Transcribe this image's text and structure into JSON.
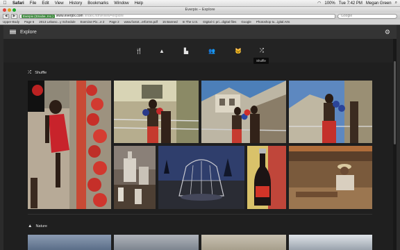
{
  "menubar": {
    "apple": "",
    "items": [
      "Safari",
      "File",
      "Edit",
      "View",
      "History",
      "Bookmarks",
      "Window",
      "Help"
    ],
    "status": {
      "battery": "100%",
      "day_time": "Tue 7:42 PM",
      "user": "Megan Green"
    }
  },
  "window": {
    "title": "Everpix – Explore"
  },
  "browser": {
    "back": "◀",
    "forward": "▶",
    "cert_label": "Everpix (33cube, Inc.)",
    "url_host": "www.everpix.com",
    "url_path": "/index.html#view=explore",
    "search_placeholder": "Google",
    "bookmarks": [
      "Upper-Body",
      "Page 6",
      "2013 Lebano...y Schedule",
      "Exercise Pix...e 2",
      "Page 2",
      "www.foxtot...erforms.pdf",
      "15 Banned",
      "In The U.S.",
      "Digital C pri...digital files",
      "Google",
      "Photoshop tu...igital Arts"
    ]
  },
  "app": {
    "title": "Explore",
    "filters": [
      {
        "name": "filter-food-icon",
        "glyph": "🍴"
      },
      {
        "name": "filter-landscape-icon",
        "glyph": "▲"
      },
      {
        "name": "filter-city-icon",
        "glyph": "▙"
      },
      {
        "name": "filter-people-icon",
        "glyph": "👥"
      },
      {
        "name": "filter-pets-icon",
        "glyph": "🐱"
      },
      {
        "name": "filter-shuffle-icon",
        "glyph": "⤮"
      }
    ],
    "tooltip": "Shuffle",
    "sections": [
      {
        "label": "Shuffle",
        "icon": "⤮"
      },
      {
        "label": "Nature",
        "icon": "▲"
      }
    ],
    "photos": [
      {
        "name": "photo-boxer-bags",
        "desc": "boxer with red gloves"
      },
      {
        "name": "photo-boxers-ring",
        "desc": "boxers in ring"
      },
      {
        "name": "photo-boxers-sparring",
        "desc": "boxers sparring outdoors"
      },
      {
        "name": "photo-boxer-pose",
        "desc": "boxer in fighting pose"
      },
      {
        "name": "photo-cemetery",
        "desc": "cemetery monuments"
      },
      {
        "name": "photo-pavilion",
        "desc": "gazebo dome at dusk"
      },
      {
        "name": "photo-bottle",
        "desc": "soda bottle"
      },
      {
        "name": "photo-market",
        "desc": "vendor at market"
      }
    ]
  },
  "colors": {
    "accent_green": "#3c8a3c",
    "background": "#1f1f1f",
    "header": "#343434"
  }
}
